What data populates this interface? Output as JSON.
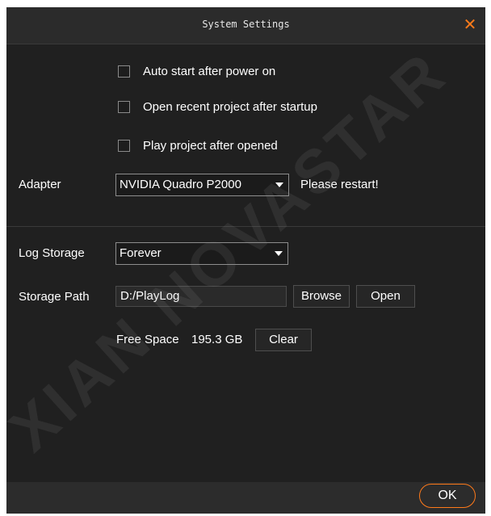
{
  "dialog": {
    "title": "System Settings",
    "close_icon": "close-icon",
    "accent_color": "#ff7a1a"
  },
  "options": {
    "auto_start": {
      "label": "Auto start after power on",
      "checked": false
    },
    "open_recent": {
      "label": "Open recent project after startup",
      "checked": false
    },
    "play_project": {
      "label": "Play project after opened",
      "checked": false
    }
  },
  "adapter": {
    "label": "Adapter",
    "selected": "NVIDIA Quadro P2000",
    "note": "Please restart!"
  },
  "log": {
    "storage_label": "Log Storage",
    "storage_selected": "Forever",
    "path_label": "Storage Path",
    "path_value": "D:/PlayLog",
    "browse_label": "Browse",
    "open_label": "Open",
    "free_space_label": "Free Space",
    "free_space_value": "195.3 GB",
    "clear_label": "Clear"
  },
  "footer": {
    "ok_label": "OK"
  },
  "watermark": {
    "text": "XIAN NOVASTAR"
  }
}
